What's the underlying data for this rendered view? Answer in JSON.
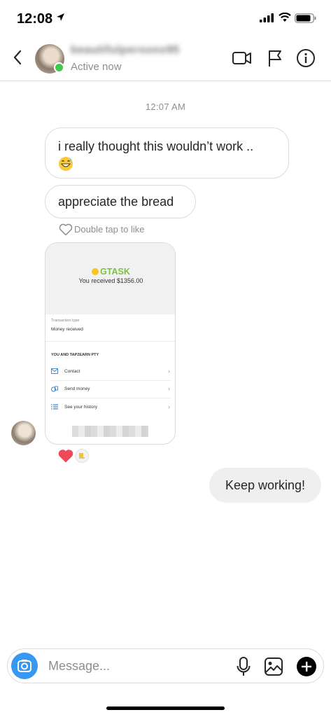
{
  "status_bar": {
    "time": "12:08"
  },
  "header": {
    "username": "beautifulpersonx95",
    "status": "Active now",
    "icons": [
      "back-chevron-icon",
      "video-call-icon",
      "flag-icon",
      "info-icon"
    ]
  },
  "thread": {
    "timestamp": "12:07 AM",
    "messages": [
      {
        "from": "them",
        "text": "i really thought this wouldn’t work ..",
        "emoji": "grinning-sweat-emoji"
      },
      {
        "from": "them",
        "text": "appreciate the bread"
      }
    ],
    "like_hint": "Double tap to like",
    "shared_card": {
      "brand": "GTASK",
      "received_text": "You received $1356.00",
      "transaction_label": "Transaction type",
      "transaction_value": "Money received",
      "section_title": "YOU AND TAP2EARN PTY",
      "rows": [
        {
          "label": "Contact",
          "icon": "mail-icon"
        },
        {
          "label": "Send money",
          "icon": "money-icon"
        },
        {
          "label": "See your history",
          "icon": "list-icon"
        }
      ]
    },
    "reactions": [
      "heart",
      "thumb"
    ],
    "reply": {
      "from": "me",
      "text": "Keep working!"
    }
  },
  "composer": {
    "placeholder": "Message...",
    "icons": [
      "camera-icon",
      "microphone-icon",
      "gallery-icon",
      "plus-icon"
    ]
  },
  "colors": {
    "accent": "#3897f0",
    "online": "#3fca4b",
    "heart": "#ed4956",
    "brand_green": "#7cc242"
  }
}
